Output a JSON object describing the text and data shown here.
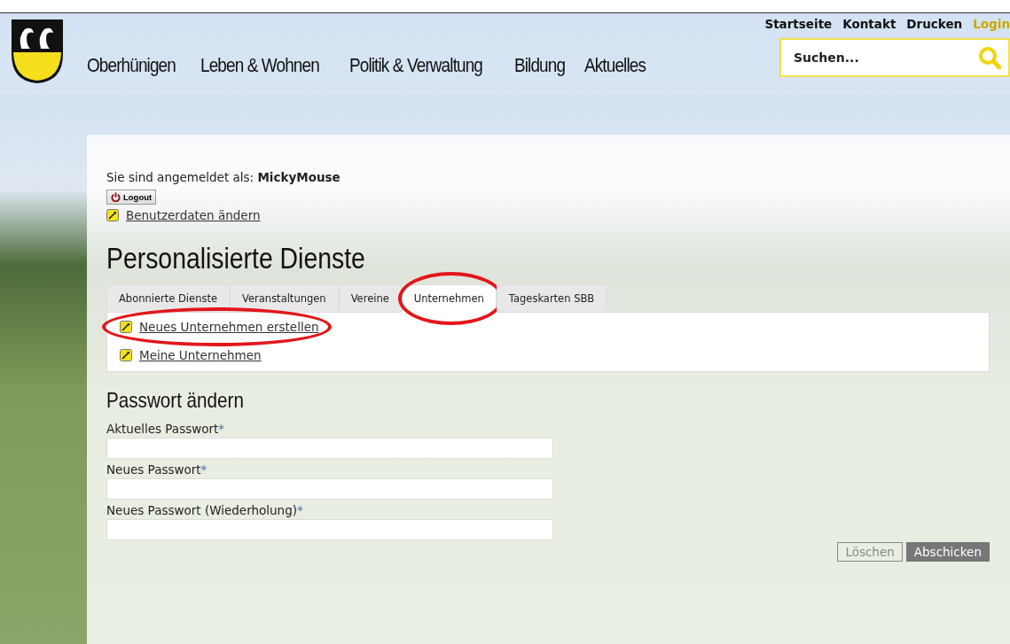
{
  "header": {
    "nav": [
      "Oberhünigen",
      "Leben & Wohnen",
      "Politik & Verwaltung",
      "Bildung",
      "Aktuelles"
    ],
    "top_links": [
      {
        "label": "Startseite",
        "highlighted": false
      },
      {
        "label": "Kontakt",
        "highlighted": false
      },
      {
        "label": "Drucken",
        "highlighted": false
      },
      {
        "label": "Login",
        "highlighted": true
      }
    ],
    "search": {
      "placeholder": "Suchen..."
    }
  },
  "account": {
    "logged_in_text": "Sie sind angemeldet als: **MickyMouse**",
    "logout_button": "Logout",
    "edit_link": "Benutzerdaten ändern"
  },
  "services": {
    "title": "Personalisierte Dienste",
    "tabs": [
      {
        "label": "Abonnierte Dienste",
        "selected": false,
        "circled": false
      },
      {
        "label": "Veranstaltungen",
        "selected": false,
        "circled": false
      },
      {
        "label": "Vereine",
        "selected": false,
        "circled": false
      },
      {
        "label": "Unternehmen",
        "selected": true,
        "circled": true
      },
      {
        "label": "Tageskarten SBB",
        "selected": false,
        "circled": false
      }
    ],
    "links": [
      {
        "label": "Neues Unternehmen erstellen",
        "circled": true
      },
      {
        "label": "Meine Unternehmen",
        "circled": false
      }
    ]
  },
  "password": {
    "title": "Passwort ändern",
    "fields": [
      {
        "label": "Aktuelles Passwort",
        "required_mark": "*"
      },
      {
        "label": "Neues Passwort",
        "required_mark": "*"
      },
      {
        "label": "Neues Passwort (Wiederholung)",
        "required_mark": "*"
      }
    ],
    "buttons": [
      {
        "label": "Löschen",
        "kind": "secondary"
      },
      {
        "label": "Abschicken",
        "kind": "primary"
      }
    ]
  }
}
